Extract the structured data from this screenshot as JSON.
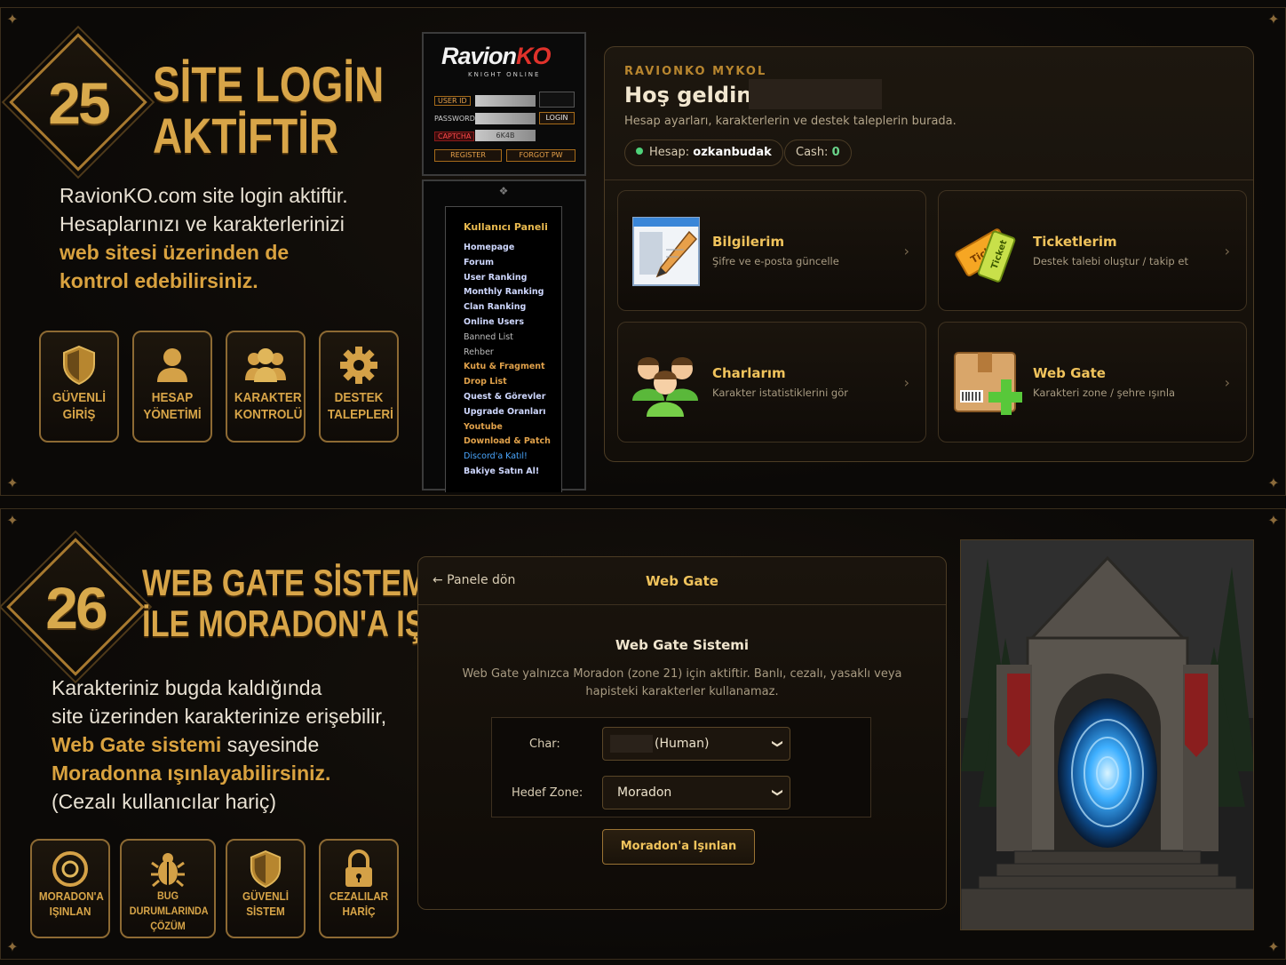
{
  "section1": {
    "number": "25",
    "headline_line1": "SİTE LOGİN",
    "headline_line2": "AKTİFTİR",
    "para_line1": "RavionKO.com site login aktiftir.",
    "para_line2": "Hesaplarınızı ve karakterlerinizi",
    "para_gold1": "web sitesi üzerinden de",
    "para_gold2": "kontrol edebilirsiniz.",
    "features": [
      {
        "line1": "GÜVENLİ",
        "line2": "GİRİŞ",
        "icon": "shield-icon"
      },
      {
        "line1": "HESAP",
        "line2": "YÖNETİMİ",
        "icon": "user-icon"
      },
      {
        "line1": "KARAKTER",
        "line2": "KONTROLÜ",
        "icon": "users-icon"
      },
      {
        "line1": "DESTEK",
        "line2": "TALEPLERİ",
        "icon": "gear-icon"
      }
    ]
  },
  "old_login": {
    "logo_main": "Ravion",
    "logo_accent": "KO",
    "logo_sub": "KNIGHT ONLINE",
    "user_id_label": "USER ID",
    "password_label": "PASSWORD",
    "login_button": "LOGIN",
    "captcha_label": "CAPTCHA",
    "captcha_code": "6K4B",
    "register_button": "REGISTER",
    "forgot_button": "FORGOT PW"
  },
  "user_panel": {
    "title": "Kullanıcı Paneli",
    "items": [
      {
        "label": "Homepage",
        "style": "normal"
      },
      {
        "label": "Forum",
        "style": "normal"
      },
      {
        "label": "User Ranking",
        "style": "normal"
      },
      {
        "label": "Monthly Ranking",
        "style": "normal"
      },
      {
        "label": "Clan Ranking",
        "style": "normal"
      },
      {
        "label": "Online Users",
        "style": "normal"
      },
      {
        "label": "Banned List",
        "style": "gray"
      },
      {
        "label": "Rehber",
        "style": "gray"
      },
      {
        "label": "Kutu & Fragment",
        "style": "orange"
      },
      {
        "label": "Drop List",
        "style": "orange"
      },
      {
        "label": "Quest & Görevler",
        "style": "normal"
      },
      {
        "label": "Upgrade Oranları",
        "style": "normal"
      },
      {
        "label": "Youtube",
        "style": "orange"
      },
      {
        "label": "Download & Patch",
        "style": "orange"
      },
      {
        "label": "Discord'a Katıl!",
        "style": "blue"
      },
      {
        "label": "Bakiye Satın Al!",
        "style": "normal"
      }
    ]
  },
  "dashboard": {
    "kicker": "RAVIONKO MYKOL",
    "welcome": "Hoş geldin,",
    "subtitle": "Hesap ayarları, karakterlerin ve destek taleplerin burada.",
    "account_label": "Hesap:",
    "account_name": "ozkanbudak",
    "cash_label": "Cash:",
    "cash_value": "0",
    "cards": [
      {
        "title": "Bilgilerim",
        "desc": "Şifre ve e-posta güncelle",
        "icon": "edit-document-icon"
      },
      {
        "title": "Ticketlerim",
        "desc": "Destek talebi oluştur / takip et",
        "icon": "ticket-icon"
      },
      {
        "title": "Charlarım",
        "desc": "Karakter istatistiklerini gör",
        "icon": "characters-icon"
      },
      {
        "title": "Web Gate",
        "desc": "Karakteri zone / şehre ışınla",
        "icon": "package-add-icon"
      }
    ]
  },
  "section2": {
    "number": "26",
    "headline_line1": "WEB GATE SİSTEMİ",
    "headline_line2": "İLE MORADON'A IŞINLAN",
    "para_line1": "Karakteriniz bugda kaldığında",
    "para_line2": "site üzerinden karakterinize erişebilir,",
    "para_gold_a": "Web Gate sistemi",
    "para_line3_rest": " sayesinde",
    "para_gold_b": "Moradonna ışınlayabilirsiniz.",
    "para_line5": "(Cezalı kullanıcılar hariç)",
    "features": [
      {
        "line1": "MORADON'A",
        "line2": "IŞINLAN",
        "icon": "portal-icon"
      },
      {
        "line1": "BUG DURUMLARINDA",
        "line2": "ÇÖZÜM",
        "icon": "bug-icon"
      },
      {
        "line1": "GÜVENLİ",
        "line2": "SİSTEM",
        "icon": "shield-icon"
      },
      {
        "line1": "CEZALILAR",
        "line2": "HARİÇ",
        "icon": "lock-icon"
      }
    ]
  },
  "webgate": {
    "back_link": "← Panele dön",
    "title": "Web Gate",
    "subtitle": "Web Gate Sistemi",
    "info": "Web Gate yalnızca Moradon (zone 21) için aktiftir. Banlı, cezalı, yasaklı veya hapisteki karakterler kullanamaz.",
    "char_label": "Char:",
    "char_value": "(Human)",
    "zone_label": "Hedef Zone:",
    "zone_value": "Moradon",
    "submit_button": "Moradon'a Işınlan"
  },
  "colors": {
    "gold": "#d8a548",
    "card_title": "#f0c35c",
    "online_dot": "#4fd27a",
    "portal_blue": "#3fb0ff"
  }
}
